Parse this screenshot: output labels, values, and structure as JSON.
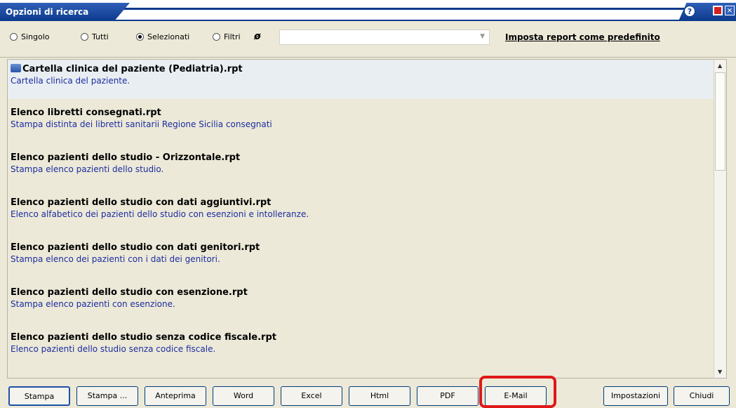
{
  "window": {
    "title": "Opzioni di ricerca",
    "help": "?"
  },
  "options": {
    "radios": [
      {
        "label": "Singolo",
        "checked": false
      },
      {
        "label": "Tutti",
        "checked": false
      },
      {
        "label": "Selezionati",
        "checked": true
      },
      {
        "label": "Filtri",
        "checked": false
      }
    ],
    "combo_value": "",
    "default_link": "Imposta report come predefinito"
  },
  "reports": [
    {
      "name": "Cartella clinica del paziente (Pediatria).rpt",
      "desc": "Cartella clinica del paziente.",
      "selected": true,
      "icon": "printer-icon"
    },
    {
      "name": "Elenco libretti consegnati.rpt",
      "desc": "Stampa distinta dei libretti sanitarii Regione Sicilia consegnati"
    },
    {
      "name": "Elenco pazienti dello studio - Orizzontale.rpt",
      "desc": "Stampa elenco pazienti dello studio."
    },
    {
      "name": "Elenco pazienti dello studio con dati aggiuntivi.rpt",
      "desc": "Elenco alfabetico dei pazienti dello studio con esenzioni e intolleranze."
    },
    {
      "name": "Elenco pazienti dello studio con dati genitori.rpt",
      "desc": "Stampa elenco dei pazienti con i dati dei genitori."
    },
    {
      "name": "Elenco pazienti dello studio con esenzione.rpt",
      "desc": "Stampa elenco pazienti con esenzione."
    },
    {
      "name": "Elenco pazienti dello studio senza codice fiscale.rpt",
      "desc": "Elenco pazienti dello studio senza codice fiscale."
    }
  ],
  "buttons": {
    "stampa": "Stampa",
    "stampa_dots": "Stampa ...",
    "anteprima": "Anteprima",
    "word": "Word",
    "excel": "Excel",
    "html": "Html",
    "pdf": "PDF",
    "email": "E-Mail",
    "impostazioni": "Impostazioni",
    "chiudi": "Chiudi"
  },
  "colors": {
    "title_bar": "#0b3a8c",
    "description_text": "#1c2ca0",
    "highlight": "#e01818"
  }
}
